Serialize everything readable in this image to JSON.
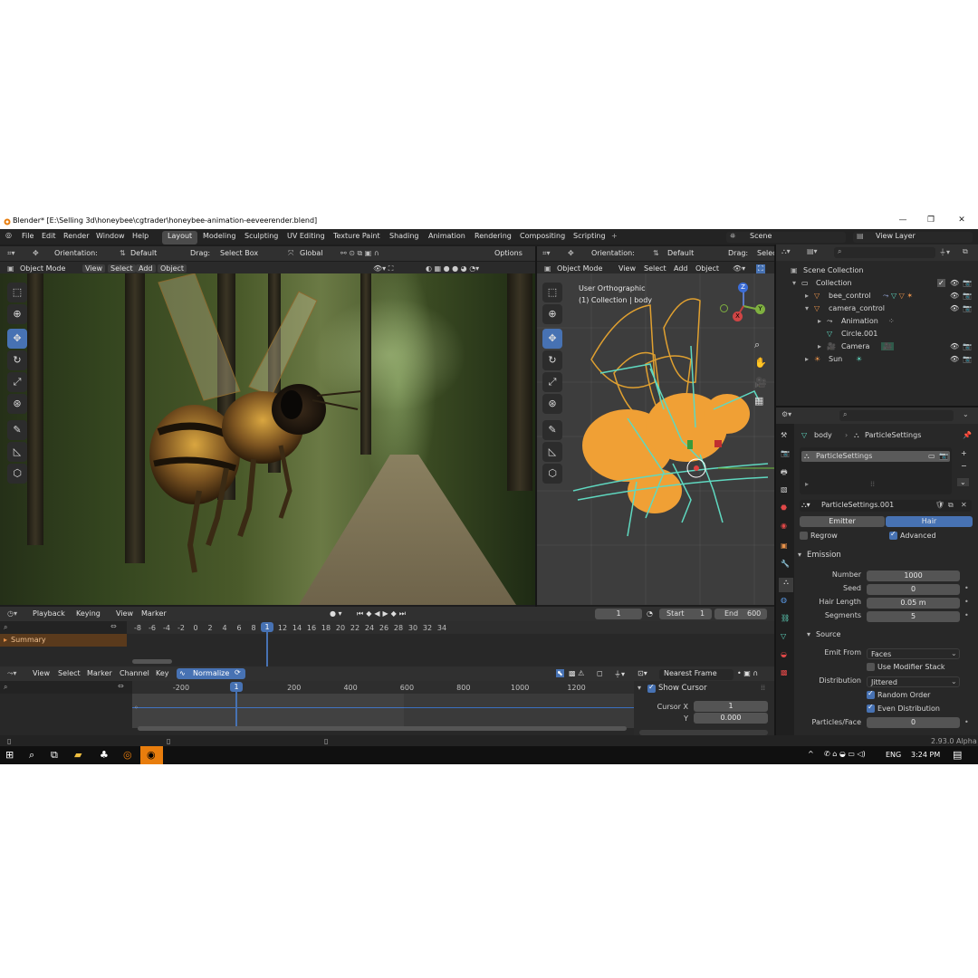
{
  "window": {
    "title": "Blender* [E:\\Selling 3d\\honeybee\\cgtrader\\honeybee-animation-eeveerender.blend]",
    "controls": [
      "—",
      "❐",
      "✕"
    ]
  },
  "menubar": {
    "menus": [
      "File",
      "Edit",
      "Render",
      "Window",
      "Help"
    ],
    "workspaces": [
      "Layout",
      "Modeling",
      "Sculpting",
      "UV Editing",
      "Texture Paint",
      "Shading",
      "Animation",
      "Rendering",
      "Compositing",
      "Scripting"
    ],
    "active_workspace": "Layout",
    "add_tab": "+",
    "scene": "Scene",
    "view_layer": "View Layer"
  },
  "left_viewport": {
    "orientation_label": "Orientation:",
    "orientation_value": "Default",
    "drag_label": "Drag:",
    "drag_value": "Select Box",
    "transform_orientation": "Global",
    "options": "Options",
    "mode": "Object Mode",
    "menus": [
      "View",
      "Select",
      "Add",
      "Object"
    ]
  },
  "right_viewport": {
    "orientation_label": "Orientation:",
    "orientation_value": "Default",
    "drag_label": "Drag:",
    "drag_value": "Selec",
    "mode": "Object Mode",
    "menus": [
      "View",
      "Select",
      "Add",
      "Object"
    ],
    "overlay_line1": "User Orthographic",
    "overlay_line2": "(1) Collection | body",
    "gizmo": {
      "z": "Z",
      "y": "Y",
      "x": "X"
    }
  },
  "outliner": {
    "root": "Scene Collection",
    "items": [
      {
        "name": "Collection",
        "indent": 1
      },
      {
        "name": "bee_control",
        "indent": 2
      },
      {
        "name": "camera_control",
        "indent": 2
      },
      {
        "name": "Animation",
        "indent": 3
      },
      {
        "name": "Circle.001",
        "indent": 3
      },
      {
        "name": "Camera",
        "indent": 3
      },
      {
        "name": "Sun",
        "indent": 2
      }
    ]
  },
  "properties": {
    "breadcrumb_object": "body",
    "breadcrumb_settings": "ParticleSettings",
    "particle_list_item": "ParticleSettings",
    "settings_name": "ParticleSettings.001",
    "type_options": [
      "Emitter",
      "Hair"
    ],
    "active_type": "Hair",
    "regrow": "Regrow",
    "advanced": "Advanced",
    "emission_panel": "Emission",
    "emission": [
      {
        "label": "Number",
        "value": "1000"
      },
      {
        "label": "Seed",
        "value": "0"
      },
      {
        "label": "Hair Length",
        "value": "0.05 m"
      },
      {
        "label": "Segments",
        "value": "5"
      }
    ],
    "source_panel": "Source",
    "emit_from_label": "Emit From",
    "emit_from_value": "Faces",
    "use_modifier_stack": "Use Modifier Stack",
    "distribution_label": "Distribution",
    "distribution_value": "Jittered",
    "random_order": "Random Order",
    "even_distribution": "Even Distribution",
    "particles_per_face_label": "Particles/Face",
    "particles_per_face_value": "0"
  },
  "timeline": {
    "menus": [
      "Playback",
      "Keying",
      "View",
      "Marker"
    ],
    "current_frame": "1",
    "start_label": "Start",
    "start_value": "1",
    "end_label": "End",
    "end_value": "600",
    "ticks": [
      "-8",
      "-6",
      "-4",
      "-2",
      "0",
      "1",
      "2",
      "4",
      "6",
      "8",
      "10",
      "12",
      "14",
      "16",
      "18",
      "20",
      "22",
      "24",
      "26",
      "28",
      "30",
      "32",
      "34"
    ],
    "summary": "Summary"
  },
  "graph_editor": {
    "menus": [
      "View",
      "Select",
      "Marker",
      "Channel",
      "Key"
    ],
    "normalize": "Normalize",
    "snap": "Nearest Frame",
    "ticks": [
      "-200",
      "1",
      "200",
      "400",
      "600",
      "800",
      "1000",
      "1200"
    ],
    "show_cursor": "Show Cursor",
    "cursor_x_label": "Cursor X",
    "cursor_x_value": "1",
    "y_label": "Y",
    "y_value": "0.000"
  },
  "statusbar": {
    "version": "2.93.0 Alpha"
  },
  "taskbar": {
    "language": "ENG",
    "time": "3:24 PM"
  }
}
